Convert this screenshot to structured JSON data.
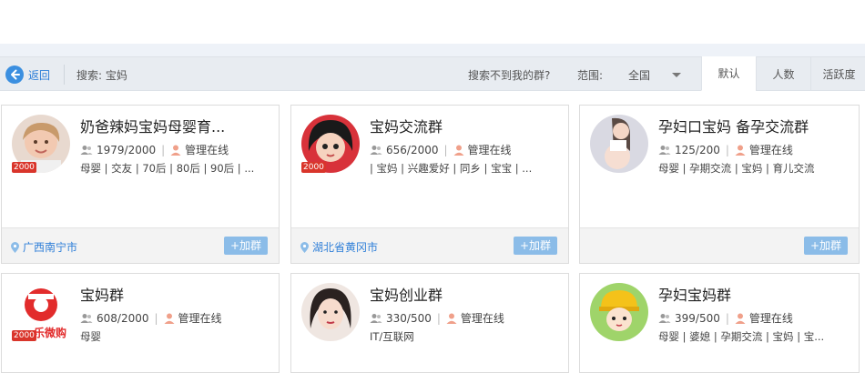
{
  "toolbar": {
    "back_label": "返回",
    "search_text": "搜索: 宝妈",
    "not_found": "搜索不到我的群?",
    "scope_label": "范围:",
    "scope_value": "全国",
    "sort_tabs": [
      "默认",
      "人数",
      "活跃度"
    ],
    "active_sort": "默认"
  },
  "colors": {
    "accent": "#3b8fe0",
    "badge": "#d9352b",
    "join_button": "#8bbce8"
  },
  "groups": [
    {
      "name": "奶爸辣妈宝妈母婴育...",
      "members": "1979/2000",
      "admin": "管理在线",
      "tags": "母婴 | 交友 | 70后 | 80后 | 90后 | ...",
      "badge": "2000",
      "location": "广西南宁市",
      "join": "+加群"
    },
    {
      "name": "宝妈交流群",
      "members": "656/2000",
      "admin": "管理在线",
      "tags": "| 宝妈 | 兴趣爱好 | 同乡 | 宝宝 | ...",
      "badge": "2000",
      "location": "湖北省黄冈市",
      "join": "+加群"
    },
    {
      "name": "孕妇口宝妈 备孕交流群",
      "members": "125/200",
      "admin": "管理在线",
      "tags": "母婴 | 孕期交流 | 宝妈 | 育儿交流",
      "location": "",
      "join": "+加群"
    },
    {
      "name": "宝妈群",
      "members": "608/2000",
      "admin": "管理在线",
      "tags": "母婴",
      "badge": "2000"
    },
    {
      "name": "宝妈创业群",
      "members": "330/500",
      "admin": "管理在线",
      "tags": "IT/互联网"
    },
    {
      "name": "孕妇宝妈群",
      "members": "399/500",
      "admin": "管理在线",
      "tags": "母婴 | 婆媳 | 孕期交流 | 宝妈 | 宝..."
    }
  ],
  "avatar_logo_text": "乐微购"
}
